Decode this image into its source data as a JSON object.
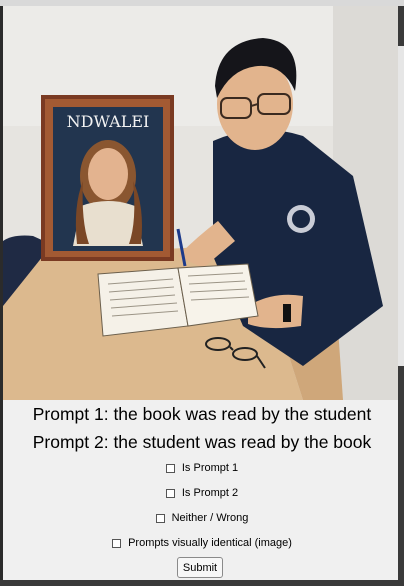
{
  "image": {
    "book_title": "NDWALEI",
    "book_subtitle": "NDWALEI"
  },
  "prompts": {
    "prompt1": "Prompt 1: the book was read by the student",
    "prompt2": "Prompt 2: the student was read by the book"
  },
  "options": [
    {
      "label": "Is Prompt 1",
      "checked": false
    },
    {
      "label": "Is Prompt 2",
      "checked": false
    },
    {
      "label": "Neither / Wrong",
      "checked": false
    },
    {
      "label": "Prompts visually identical (image)",
      "checked": false
    }
  ],
  "submit_label": "Submit",
  "icons": {
    "checkbox": "checkbox-icon"
  }
}
